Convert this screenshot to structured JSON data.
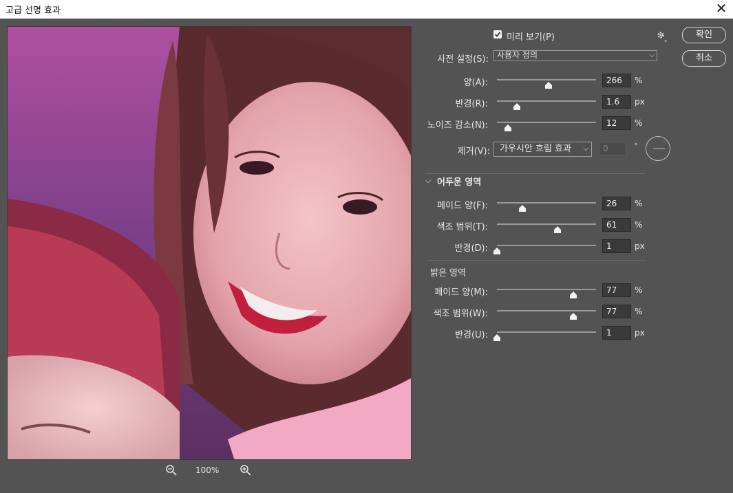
{
  "window": {
    "title": "고급 선명 효과",
    "close_glyph": "✕"
  },
  "buttons": {
    "ok": "확인",
    "cancel": "취소"
  },
  "preview": {
    "checkbox_label": "미리 보기(P)",
    "checked": true,
    "zoom": "100%"
  },
  "preset": {
    "label": "사전 설정(S):",
    "value": "사용자 정의"
  },
  "main_controls": [
    {
      "label": "양(A):",
      "value": "266",
      "unit": "%",
      "slider_fraction": 0.52
    },
    {
      "label": "반경(R):",
      "value": "1.6",
      "unit": "px",
      "slider_fraction": 0.2
    },
    {
      "label": "노이즈 감소(N):",
      "value": "12",
      "unit": "%",
      "slider_fraction": 0.11
    }
  ],
  "remove": {
    "label": "제거(V):",
    "value": "가우시안 흐림 효과",
    "angle": "0",
    "degree": "°"
  },
  "shadows": {
    "title": "어두운 영역",
    "controls": [
      {
        "label": "페이드 양(F):",
        "value": "26",
        "unit": "%",
        "slider_fraction": 0.26
      },
      {
        "label": "색조 범위(T):",
        "value": "61",
        "unit": "%",
        "slider_fraction": 0.61
      },
      {
        "label": "반경(D):",
        "value": "1",
        "unit": "px",
        "slider_fraction": 0.0
      }
    ]
  },
  "highlights": {
    "title": "밝은 영역",
    "controls": [
      {
        "label": "페이드 양(M):",
        "value": "77",
        "unit": "%",
        "slider_fraction": 0.77
      },
      {
        "label": "색조 범위(W):",
        "value": "77",
        "unit": "%",
        "slider_fraction": 0.77
      },
      {
        "label": "반경(U):",
        "value": "1",
        "unit": "px",
        "slider_fraction": 0.0
      }
    ]
  },
  "icons": {
    "close": "close-icon",
    "gear": "gear-icon",
    "zoom_in": "zoom-in-icon",
    "zoom_out": "zoom-out-icon",
    "chevron": "chevron-down-icon",
    "check": "check-icon"
  },
  "colors": {
    "panel": "#535353",
    "field": "#3a3a3a",
    "slider_track": "#9a9a9a",
    "thumb": "#f2f2f2"
  }
}
